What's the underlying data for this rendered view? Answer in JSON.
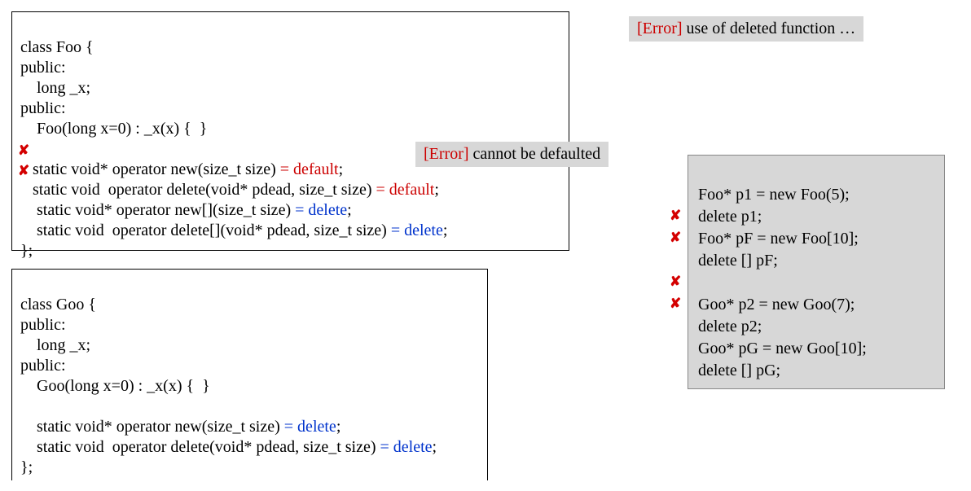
{
  "errorBox1": {
    "label": "[Error]",
    "msg": " use of deleted function …"
  },
  "errorBox2": {
    "label": "[Error]",
    "msg": " cannot be defaulted"
  },
  "foo": {
    "l1": "class Foo {",
    "l2": "public:",
    "l3": "    long _x;",
    "l4": "public:",
    "l5": "    Foo(long x=0) : _x(x) {  }",
    "l6": "",
    "l7a": "   static void* operator new(size_t size)",
    "l7b": " = default",
    "l7c": ";",
    "l8a": "   static void  operator delete(void* pdead, size_t size)",
    "l8b": " = default",
    "l8c": ";",
    "l9a": "    static void* operator new[](size_t size)",
    "l9b": " = delete",
    "l9c": ";",
    "l10a": "    static void  operator delete[](void* pdead, size_t size)",
    "l10b": " = delete",
    "l10c": ";",
    "l11": "};"
  },
  "goo": {
    "l1": "class Goo {",
    "l2": "public:",
    "l3": "    long _x;",
    "l4": "public:",
    "l5": "    Goo(long x=0) : _x(x) {  }",
    "l6": "",
    "l7a": "    static void* operator new(size_t size)",
    "l7b": " = delete",
    "l7c": ";",
    "l8a": "    static void  operator delete(void* pdead, size_t size)",
    "l8b": " = delete",
    "l8c": ";",
    "l9": "};"
  },
  "usage": {
    "l1": "Foo* p1 = new Foo(5);",
    "l2": "delete p1;",
    "l3": "Foo* pF = new Foo[10];",
    "l4": "delete [] pF;",
    "l5": "",
    "l6": "Goo* p2 = new Goo(7);",
    "l7": "delete p2;",
    "l8": "Goo* pG = new Goo[10];",
    "l9": "delete [] pG;"
  },
  "xmark": "✘"
}
